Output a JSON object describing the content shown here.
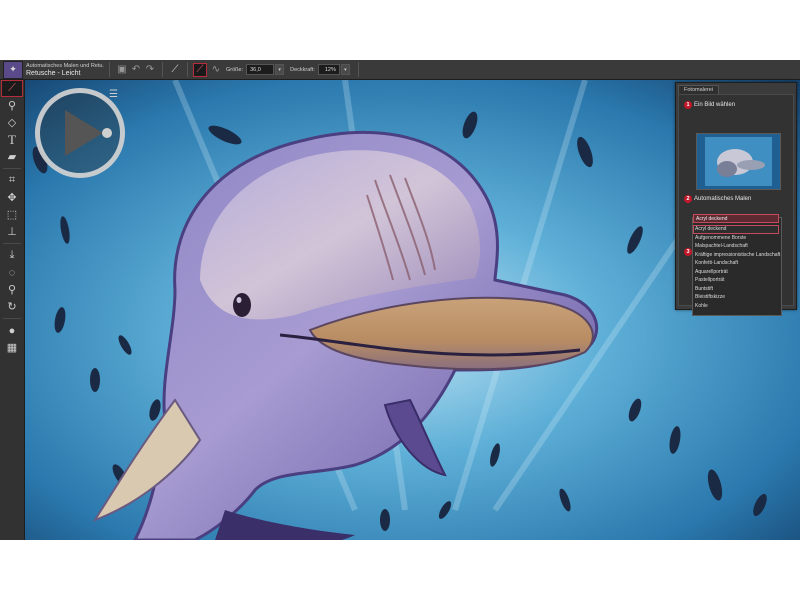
{
  "toolbar": {
    "preset_title": "Automatisches Malen und Retu...",
    "preset_subtitle": "Retusche - Leicht",
    "size_label": "Größe:",
    "size_value": "36,0",
    "opacity_label": "Deckkraft:",
    "opacity_value": "12%"
  },
  "panel": {
    "tab_label": "Fotomalerei",
    "steps": [
      {
        "num": "1",
        "label": "Ein Bild wählen"
      },
      {
        "num": "2",
        "label": "Automatisches Malen"
      },
      {
        "num": "3",
        "label": ""
      }
    ],
    "dropdown_selected": "Acryl deckend",
    "dropdown_items": [
      "Acryl deckend",
      "Aufgenommene Borste",
      "Malspachtel-Landschaft",
      "Kräftige impressionistische Landschaft",
      "Konfetti-Landschaft",
      "Aquarellporträt",
      "Pastellporträt",
      "Buntstift",
      "Bleistiftskizze",
      "Kohle"
    ]
  },
  "colors": {
    "accent": "#c0182a",
    "ui_background": "#2b2b2b",
    "ocean": "#2f7fb0"
  },
  "icons": {
    "tools": [
      "brush-icon",
      "eyedropper-icon",
      "fill-bucket-icon",
      "text-icon",
      "eraser-icon",
      "crop-icon",
      "move-icon",
      "selection-icon",
      "stamp-icon",
      "smudge-icon",
      "lasso-icon",
      "zoom-icon",
      "rotate-icon",
      "color-swatch-icon",
      "texture-icon"
    ]
  }
}
